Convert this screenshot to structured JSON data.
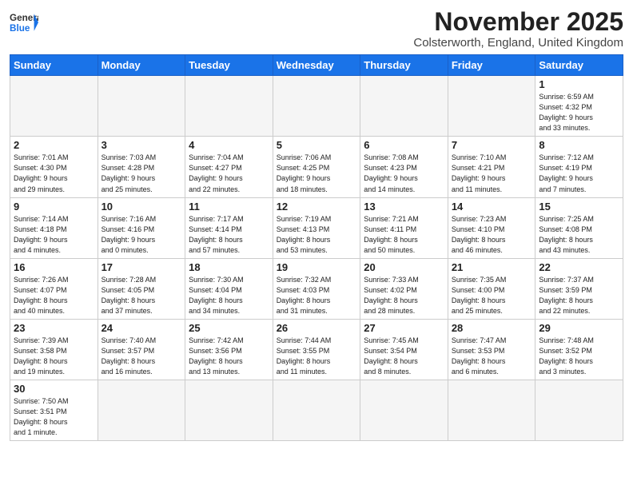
{
  "header": {
    "logo_general": "General",
    "logo_blue": "Blue",
    "month": "November 2025",
    "location": "Colsterworth, England, United Kingdom"
  },
  "weekdays": [
    "Sunday",
    "Monday",
    "Tuesday",
    "Wednesday",
    "Thursday",
    "Friday",
    "Saturday"
  ],
  "weeks": [
    [
      {
        "day": "",
        "info": "",
        "empty": true
      },
      {
        "day": "",
        "info": "",
        "empty": true
      },
      {
        "day": "",
        "info": "",
        "empty": true
      },
      {
        "day": "",
        "info": "",
        "empty": true
      },
      {
        "day": "",
        "info": "",
        "empty": true
      },
      {
        "day": "",
        "info": "",
        "empty": true
      },
      {
        "day": "1",
        "info": "Sunrise: 6:59 AM\nSunset: 4:32 PM\nDaylight: 9 hours\nand 33 minutes."
      }
    ],
    [
      {
        "day": "2",
        "info": "Sunrise: 7:01 AM\nSunset: 4:30 PM\nDaylight: 9 hours\nand 29 minutes."
      },
      {
        "day": "3",
        "info": "Sunrise: 7:03 AM\nSunset: 4:28 PM\nDaylight: 9 hours\nand 25 minutes."
      },
      {
        "day": "4",
        "info": "Sunrise: 7:04 AM\nSunset: 4:27 PM\nDaylight: 9 hours\nand 22 minutes."
      },
      {
        "day": "5",
        "info": "Sunrise: 7:06 AM\nSunset: 4:25 PM\nDaylight: 9 hours\nand 18 minutes."
      },
      {
        "day": "6",
        "info": "Sunrise: 7:08 AM\nSunset: 4:23 PM\nDaylight: 9 hours\nand 14 minutes."
      },
      {
        "day": "7",
        "info": "Sunrise: 7:10 AM\nSunset: 4:21 PM\nDaylight: 9 hours\nand 11 minutes."
      },
      {
        "day": "8",
        "info": "Sunrise: 7:12 AM\nSunset: 4:19 PM\nDaylight: 9 hours\nand 7 minutes."
      }
    ],
    [
      {
        "day": "9",
        "info": "Sunrise: 7:14 AM\nSunset: 4:18 PM\nDaylight: 9 hours\nand 4 minutes."
      },
      {
        "day": "10",
        "info": "Sunrise: 7:16 AM\nSunset: 4:16 PM\nDaylight: 9 hours\nand 0 minutes."
      },
      {
        "day": "11",
        "info": "Sunrise: 7:17 AM\nSunset: 4:14 PM\nDaylight: 8 hours\nand 57 minutes."
      },
      {
        "day": "12",
        "info": "Sunrise: 7:19 AM\nSunset: 4:13 PM\nDaylight: 8 hours\nand 53 minutes."
      },
      {
        "day": "13",
        "info": "Sunrise: 7:21 AM\nSunset: 4:11 PM\nDaylight: 8 hours\nand 50 minutes."
      },
      {
        "day": "14",
        "info": "Sunrise: 7:23 AM\nSunset: 4:10 PM\nDaylight: 8 hours\nand 46 minutes."
      },
      {
        "day": "15",
        "info": "Sunrise: 7:25 AM\nSunset: 4:08 PM\nDaylight: 8 hours\nand 43 minutes."
      }
    ],
    [
      {
        "day": "16",
        "info": "Sunrise: 7:26 AM\nSunset: 4:07 PM\nDaylight: 8 hours\nand 40 minutes."
      },
      {
        "day": "17",
        "info": "Sunrise: 7:28 AM\nSunset: 4:05 PM\nDaylight: 8 hours\nand 37 minutes."
      },
      {
        "day": "18",
        "info": "Sunrise: 7:30 AM\nSunset: 4:04 PM\nDaylight: 8 hours\nand 34 minutes."
      },
      {
        "day": "19",
        "info": "Sunrise: 7:32 AM\nSunset: 4:03 PM\nDaylight: 8 hours\nand 31 minutes."
      },
      {
        "day": "20",
        "info": "Sunrise: 7:33 AM\nSunset: 4:02 PM\nDaylight: 8 hours\nand 28 minutes."
      },
      {
        "day": "21",
        "info": "Sunrise: 7:35 AM\nSunset: 4:00 PM\nDaylight: 8 hours\nand 25 minutes."
      },
      {
        "day": "22",
        "info": "Sunrise: 7:37 AM\nSunset: 3:59 PM\nDaylight: 8 hours\nand 22 minutes."
      }
    ],
    [
      {
        "day": "23",
        "info": "Sunrise: 7:39 AM\nSunset: 3:58 PM\nDaylight: 8 hours\nand 19 minutes."
      },
      {
        "day": "24",
        "info": "Sunrise: 7:40 AM\nSunset: 3:57 PM\nDaylight: 8 hours\nand 16 minutes."
      },
      {
        "day": "25",
        "info": "Sunrise: 7:42 AM\nSunset: 3:56 PM\nDaylight: 8 hours\nand 13 minutes."
      },
      {
        "day": "26",
        "info": "Sunrise: 7:44 AM\nSunset: 3:55 PM\nDaylight: 8 hours\nand 11 minutes."
      },
      {
        "day": "27",
        "info": "Sunrise: 7:45 AM\nSunset: 3:54 PM\nDaylight: 8 hours\nand 8 minutes."
      },
      {
        "day": "28",
        "info": "Sunrise: 7:47 AM\nSunset: 3:53 PM\nDaylight: 8 hours\nand 6 minutes."
      },
      {
        "day": "29",
        "info": "Sunrise: 7:48 AM\nSunset: 3:52 PM\nDaylight: 8 hours\nand 3 minutes."
      }
    ],
    [
      {
        "day": "30",
        "info": "Sunrise: 7:50 AM\nSunset: 3:51 PM\nDaylight: 8 hours\nand 1 minute."
      },
      {
        "day": "",
        "info": "",
        "empty": true
      },
      {
        "day": "",
        "info": "",
        "empty": true
      },
      {
        "day": "",
        "info": "",
        "empty": true
      },
      {
        "day": "",
        "info": "",
        "empty": true
      },
      {
        "day": "",
        "info": "",
        "empty": true
      },
      {
        "day": "",
        "info": "",
        "empty": true
      }
    ]
  ]
}
